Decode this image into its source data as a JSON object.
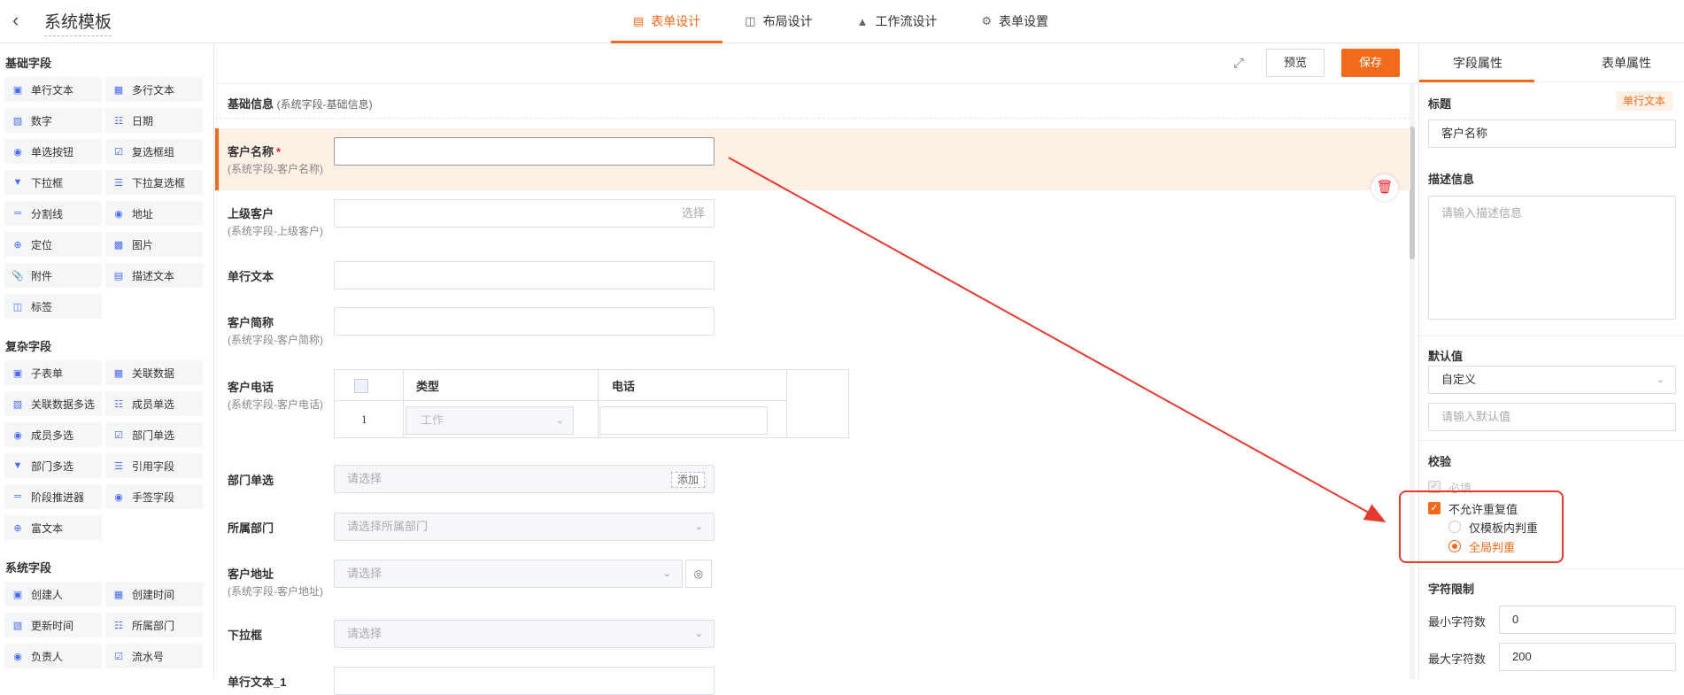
{
  "header": {
    "title": "系统模板",
    "tabs": [
      {
        "label": "表单设计",
        "icon": "form-icon"
      },
      {
        "label": "布局设计",
        "icon": "layout-icon"
      },
      {
        "label": "工作流设计",
        "icon": "workflow-icon"
      },
      {
        "label": "表单设置",
        "icon": "gear-icon"
      }
    ]
  },
  "left": {
    "basic_title": "基础字段",
    "basic": [
      "单行文本",
      "多行文本",
      "数字",
      "日期",
      "单选按钮",
      "复选框组",
      "下拉框",
      "下拉复选框",
      "分割线",
      "地址",
      "定位",
      "图片",
      "附件",
      "描述文本",
      "标签"
    ],
    "complex_title": "复杂字段",
    "complex": [
      "子表单",
      "关联数据",
      "关联数据多选",
      "成员单选",
      "成员多选",
      "部门单选",
      "部门多选",
      "引用字段",
      "阶段推进器",
      "手签字段",
      "富文本"
    ],
    "system_title": "系统字段",
    "system": [
      "创建人",
      "创建时间",
      "更新时间",
      "所属部门",
      "负责人",
      "流水号"
    ]
  },
  "canvas": {
    "preview": "预览",
    "save": "保存",
    "section_title": "基础信息",
    "section_sub": "(系统字段-基础信息)",
    "fields": {
      "customer_name": {
        "label": "客户名称",
        "required": "*",
        "sub": "(系统字段-客户名称)"
      },
      "parent_customer": {
        "label": "上级客户",
        "sub": "(系统字段-上级客户)",
        "placeholder": "选择"
      },
      "single_text": {
        "label": "单行文本"
      },
      "short_name": {
        "label": "客户简称",
        "sub": "(系统字段-客户简称)"
      },
      "phone": {
        "label": "客户电话",
        "sub": "(系统字段-客户电话)",
        "col_type": "类型",
        "col_phone": "电话",
        "row_no": "1",
        "row_type": "工作"
      },
      "dept_single": {
        "label": "部门单选",
        "placeholder": "请选择",
        "add": "添加"
      },
      "dept_belong": {
        "label": "所属部门",
        "placeholder": "请选择所属部门"
      },
      "address": {
        "label": "客户地址",
        "sub": "(系统字段-客户地址)",
        "placeholder": "请选择"
      },
      "dropdown": {
        "label": "下拉框",
        "placeholder": "请选择"
      },
      "single_text_1": {
        "label": "单行文本_1"
      }
    }
  },
  "right": {
    "tab_field": "字段属性",
    "tab_form": "表单属性",
    "title_label": "标题",
    "type_tag": "单行文本",
    "title_value": "客户名称",
    "desc_label": "描述信息",
    "desc_placeholder": "请输入描述信息",
    "default_label": "默认值",
    "default_mode": "自定义",
    "default_placeholder": "请输入默认值",
    "validate_label": "校验",
    "required_text": "必填",
    "no_dup_text": "不允许重复值",
    "in_template": "仅模板内判重",
    "global": "全局判重",
    "limit_label": "字符限制",
    "min_label": "最小字符数",
    "min_value": "0",
    "max_label": "最大字符数",
    "max_value": "200"
  },
  "colors": {
    "accent": "#f26b1d",
    "annotation": "#e53a2f"
  }
}
